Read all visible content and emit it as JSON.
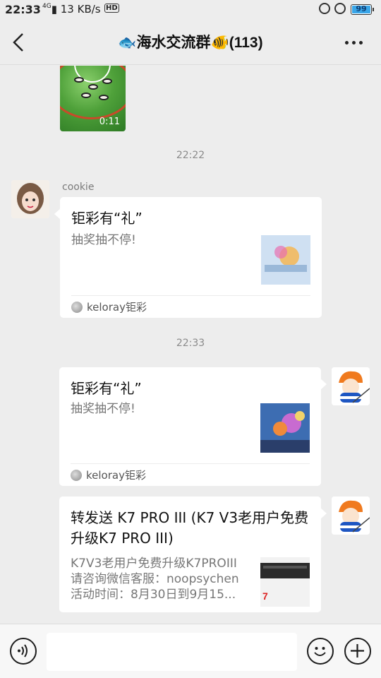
{
  "status_bar": {
    "time": "22:33",
    "net_type": "4G",
    "speed": "13 KB/s",
    "hd": "HD",
    "battery": "99",
    "battery_level": 0.99
  },
  "header": {
    "title": "🐟海水交流群🐠(113)",
    "back_icon": "chevron-left-icon",
    "more_icon": "more-dots-icon"
  },
  "messages": {
    "video": {
      "duration": "0:11"
    },
    "time1": "22:22",
    "msg1": {
      "sender": "cookie",
      "title": "钜彩有“礼”",
      "desc": "抽奖抽不停!",
      "source": "keloray钜彩"
    },
    "time2": "22:33",
    "msg2": {
      "title": "钜彩有“礼”",
      "desc": "抽奖抽不停!",
      "source": "keloray钜彩"
    },
    "msg3": {
      "title": "转发送 K7 PRO III (K7 V3老用户免费升级K7 PRO III)",
      "desc_lines": [
        "K7V3老用户免费升级K7PROIII",
        "请咨询微信客服：noopsychen",
        "活动时间：8月30日到9月15..."
      ],
      "thumb_text": "7"
    }
  },
  "input_bar": {
    "voice_icon": "voice-icon",
    "emoji_icon": "emoji-icon",
    "plus_icon": "plus-icon",
    "placeholder": ""
  }
}
